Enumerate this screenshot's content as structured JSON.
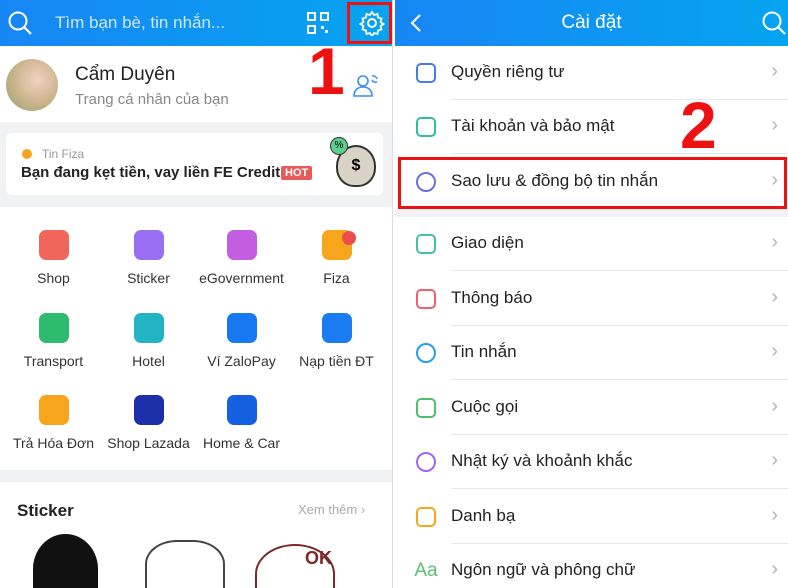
{
  "left": {
    "search_placeholder": "Tìm bạn bè, tin nhắn...",
    "profile": {
      "name": "Cẩm Duyên",
      "subtitle": "Trang cá nhân của bạn"
    },
    "banner": {
      "source": "Tin Fiza",
      "text": "Bạn đang kẹt tiền, vay liền FE Credit!",
      "badge": "HOT"
    },
    "apps": [
      {
        "label": "Shop",
        "icon": "shopping-bag-icon",
        "color": "#f0665a"
      },
      {
        "label": "Sticker",
        "icon": "sticker-smile-icon",
        "color": "#9a6ef0"
      },
      {
        "label": "eGovernment",
        "icon": "government-building-icon",
        "color": "#c45ee0"
      },
      {
        "label": "Fiza",
        "icon": "fiza-coin-icon",
        "color": "#f7a51c"
      },
      {
        "label": "Transport",
        "icon": "bus-icon",
        "color": "#2dbb6e"
      },
      {
        "label": "Hotel",
        "icon": "hotel-icon",
        "color": "#22b3c4"
      },
      {
        "label": "Ví ZaloPay",
        "icon": "zalopay-icon",
        "color": "#1877f2"
      },
      {
        "label": "Nạp tiền ĐT",
        "icon": "phone-topup-icon",
        "color": "#1a7cf0"
      },
      {
        "label": "Trả Hóa Đơn",
        "icon": "bill-icon",
        "color": "#f7a51c"
      },
      {
        "label": "Shop Lazada",
        "icon": "lazada-icon",
        "color": "#1a2fa8"
      },
      {
        "label": "Home & Car",
        "icon": "home-car-icon",
        "color": "#1560e0"
      }
    ],
    "sticker_section": {
      "title": "Sticker",
      "more": "Xem thêm"
    },
    "annotation": "1"
  },
  "right": {
    "title": "Cài đặt",
    "items": [
      {
        "label": "Quyền riêng tư",
        "icon": "lock-icon",
        "color": "#3f7ef0"
      },
      {
        "label": "Tài khoản và bảo mật",
        "icon": "shield-icon",
        "color": "#2fbf9f"
      },
      {
        "label": "Sao lưu & đồng bộ tin nhắn",
        "icon": "history-clock-icon",
        "color": "#6b6ee0"
      },
      {
        "label": "Giao diện",
        "icon": "paint-brush-icon",
        "color": "#3fc4a8"
      },
      {
        "label": "Thông báo",
        "icon": "bell-icon",
        "color": "#f06070"
      },
      {
        "label": "Tin nhắn",
        "icon": "chat-bubble-icon",
        "color": "#2a9df0"
      },
      {
        "label": "Cuộc gọi",
        "icon": "phone-icon",
        "color": "#4cc06a"
      },
      {
        "label": "Nhật ký và khoảnh khắc",
        "icon": "clock-icon",
        "color": "#a065f0"
      },
      {
        "label": "Danh bạ",
        "icon": "contact-person-icon",
        "color": "#f7a51c"
      },
      {
        "label": "Ngôn ngữ và phông chữ",
        "icon": "font-aa-icon",
        "color": "#5cc070"
      }
    ],
    "annotation": "2"
  }
}
